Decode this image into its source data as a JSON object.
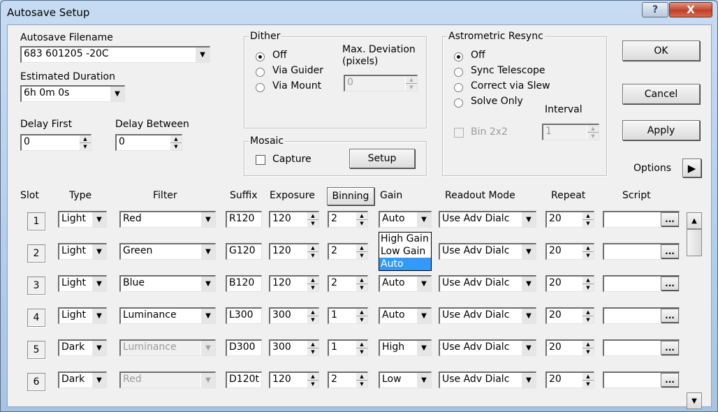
{
  "window": {
    "title": "Autosave Setup",
    "help_label": "?",
    "close_label": "X"
  },
  "filename": {
    "label": "Autosave Filename",
    "value": "683 601205 -20C"
  },
  "duration": {
    "label": "Estimated Duration",
    "value": "6h 0m 0s"
  },
  "delay_first": {
    "label": "Delay First",
    "value": "0"
  },
  "delay_between": {
    "label": "Delay Between",
    "value": "0"
  },
  "dither": {
    "title": "Dither",
    "options": [
      "Off",
      "Via Guider",
      "Via Mount"
    ],
    "selected": "Off",
    "max_dev_label": "Max. Deviation (pixels)",
    "max_dev_value": "0"
  },
  "mosaic": {
    "title": "Mosaic",
    "capture_label": "Capture",
    "setup_label": "Setup"
  },
  "astro": {
    "title": "Astrometric Resync",
    "options": [
      "Off",
      "Sync Telescope",
      "Correct via Slew",
      "Solve Only"
    ],
    "selected": "Off",
    "bin_label": "Bin 2x2",
    "interval_label": "Interval",
    "interval_value": "1"
  },
  "buttons": {
    "ok": "OK",
    "cancel": "Cancel",
    "apply": "Apply",
    "options": "Options"
  },
  "columns": {
    "slot": "Slot",
    "type": "Type",
    "filter": "Filter",
    "suffix": "Suffix",
    "exposure": "Exposure",
    "binning": "Binning",
    "gain": "Gain",
    "readout": "Readout Mode",
    "repeat": "Repeat",
    "script": "Script"
  },
  "rows": [
    {
      "slot": "1",
      "type": "Light",
      "filter": "Red",
      "suffix": "R120",
      "exposure": "120",
      "binning": "2",
      "gain": "Auto",
      "readout": "Use Adv Dialc",
      "repeat": "20",
      "script": "...",
      "filter_disabled": false
    },
    {
      "slot": "2",
      "type": "Light",
      "filter": "Green",
      "suffix": "G120",
      "exposure": "120",
      "binning": "2",
      "gain": "Auto",
      "readout": "Use Adv Dialc",
      "repeat": "20",
      "script": "...",
      "filter_disabled": false
    },
    {
      "slot": "3",
      "type": "Light",
      "filter": "Blue",
      "suffix": "B120",
      "exposure": "120",
      "binning": "2",
      "gain": "Auto",
      "readout": "Use Adv Dialc",
      "repeat": "20",
      "script": "...",
      "filter_disabled": false
    },
    {
      "slot": "4",
      "type": "Light",
      "filter": "Luminance",
      "suffix": "L300",
      "exposure": "300",
      "binning": "1",
      "gain": "Auto",
      "readout": "Use Adv Dialc",
      "repeat": "20",
      "script": "...",
      "filter_disabled": false
    },
    {
      "slot": "5",
      "type": "Dark",
      "filter": "Luminance",
      "suffix": "D300",
      "exposure": "300",
      "binning": "1",
      "gain": "High",
      "readout": "Use Adv Dialc",
      "repeat": "20",
      "script": "...",
      "filter_disabled": true
    },
    {
      "slot": "6",
      "type": "Dark",
      "filter": "Red",
      "suffix": "D120t",
      "exposure": "120",
      "binning": "2",
      "gain": "Low",
      "readout": "Use Adv Dialc",
      "repeat": "20",
      "script": "...",
      "filter_disabled": true
    }
  ],
  "gain_dropdown": {
    "options": [
      "High Gain",
      "Low Gain",
      "Auto"
    ],
    "selected": "Auto"
  }
}
